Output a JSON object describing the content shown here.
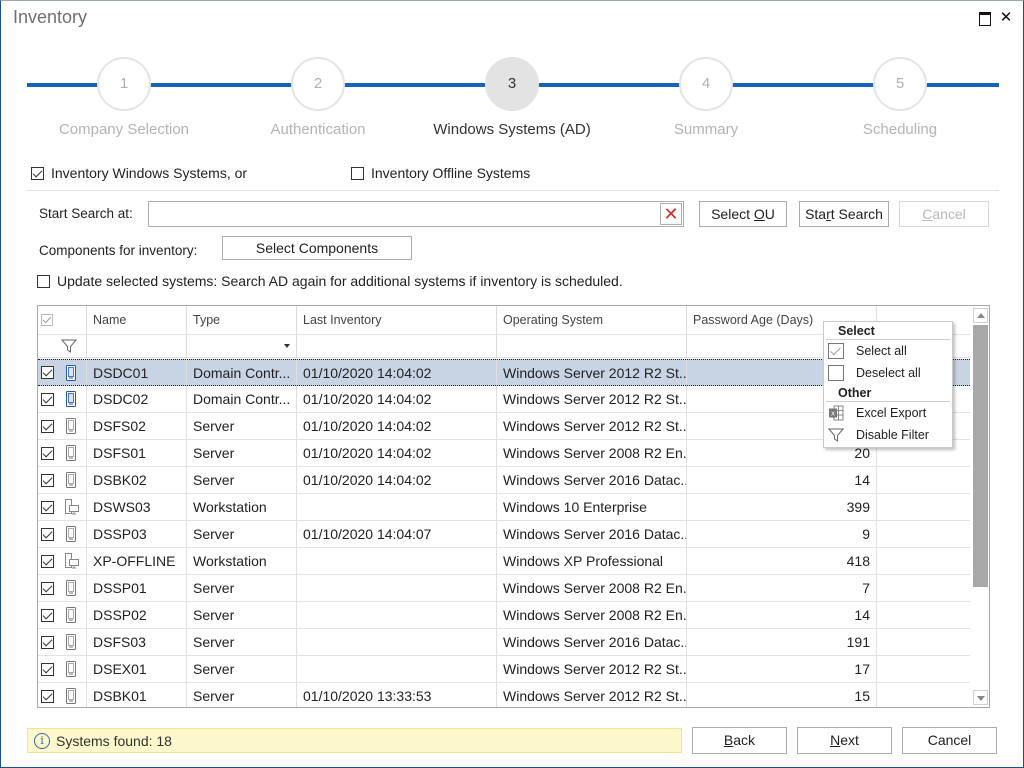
{
  "window": {
    "title": "Inventory",
    "maximize_icon": "maximize-icon",
    "close_glyph": "✕"
  },
  "stepper": {
    "active_step": 3,
    "steps": [
      {
        "number": "1",
        "label": "Company Selection"
      },
      {
        "number": "2",
        "label": "Authentication"
      },
      {
        "number": "3",
        "label": "Windows Systems (AD)"
      },
      {
        "number": "4",
        "label": "Summary"
      },
      {
        "number": "5",
        "label": "Scheduling"
      }
    ],
    "accent_color": "#1565b8"
  },
  "options": {
    "inventory_windows": {
      "label": "Inventory Windows Systems, or",
      "checked": true
    },
    "inventory_offline": {
      "label": "Inventory Offline Systems",
      "checked": false
    }
  },
  "search": {
    "label": "Start Search at:",
    "value": "",
    "placeholder": "",
    "clear_glyph": "✕",
    "select_ou_pre": "Select ",
    "select_ou_u": "O",
    "select_ou_post": "U",
    "start_pre": "Sta",
    "start_u": "r",
    "start_post": "t Search",
    "cancel_u": "C",
    "cancel_post": "ancel"
  },
  "components": {
    "label": "Components for inventory:",
    "button": "Select Components"
  },
  "update_option": {
    "label": "Update selected systems: Search AD again for additional systems if inventory is scheduled.",
    "checked": false
  },
  "grid": {
    "columns": [
      "Name",
      "Type",
      "Last Inventory",
      "Operating System",
      "Password Age (Days)"
    ],
    "rows": [
      {
        "checked": true,
        "icon": "domain-controller",
        "name": "DSDC01",
        "type": "Domain Contr...",
        "last": "01/10/2020 14:04:02",
        "os": "Windows Server 2012 R2 St...",
        "pw": "",
        "selected": true
      },
      {
        "checked": true,
        "icon": "domain-controller",
        "name": "DSDC02",
        "type": "Domain Contr...",
        "last": "01/10/2020 14:04:02",
        "os": "Windows Server 2012 R2 St...",
        "pw": ""
      },
      {
        "checked": true,
        "icon": "server",
        "name": "DSFS02",
        "type": "Server",
        "last": "01/10/2020 14:04:02",
        "os": "Windows Server 2012 R2 St...",
        "pw": ""
      },
      {
        "checked": true,
        "icon": "server",
        "name": "DSFS01",
        "type": "Server",
        "last": "01/10/2020 14:04:02",
        "os": "Windows Server 2008 R2 En...",
        "pw": "20"
      },
      {
        "checked": true,
        "icon": "server",
        "name": "DSBK02",
        "type": "Server",
        "last": "01/10/2020 14:04:02",
        "os": "Windows Server 2016 Datac...",
        "pw": "14"
      },
      {
        "checked": true,
        "icon": "workstation",
        "name": "DSWS03",
        "type": "Workstation",
        "last": "",
        "os": "Windows 10 Enterprise",
        "pw": "399"
      },
      {
        "checked": true,
        "icon": "server",
        "name": "DSSP03",
        "type": "Server",
        "last": "01/10/2020 14:04:07",
        "os": "Windows Server 2016 Datac...",
        "pw": "9"
      },
      {
        "checked": true,
        "icon": "workstation",
        "name": "XP-OFFLINE",
        "type": "Workstation",
        "last": "",
        "os": "Windows XP Professional",
        "pw": "418"
      },
      {
        "checked": true,
        "icon": "server",
        "name": "DSSP01",
        "type": "Server",
        "last": "",
        "os": "Windows Server 2008 R2 En...",
        "pw": "7"
      },
      {
        "checked": true,
        "icon": "server",
        "name": "DSSP02",
        "type": "Server",
        "last": "",
        "os": "Windows Server 2008 R2 En...",
        "pw": "14"
      },
      {
        "checked": true,
        "icon": "server",
        "name": "DSFS03",
        "type": "Server",
        "last": "",
        "os": "Windows Server 2016 Datac...",
        "pw": "191"
      },
      {
        "checked": true,
        "icon": "server",
        "name": "DSEX01",
        "type": "Server",
        "last": "",
        "os": "Windows Server 2012 R2 St...",
        "pw": "17"
      },
      {
        "checked": true,
        "icon": "server",
        "name": "DSBK01",
        "type": "Server",
        "last": "01/10/2020 13:33:53",
        "os": "Windows Server 2012 R2 St...",
        "pw": "15"
      }
    ]
  },
  "context_menu": {
    "select_header": "Select",
    "select_all": "Select all",
    "deselect_all": "Deselect all",
    "other_header": "Other",
    "excel_export": "Excel Export",
    "disable_filter": "Disable Filter"
  },
  "footer": {
    "status_text": "Systems found:  18",
    "back_u": "B",
    "back_post": "ack",
    "next_u": "N",
    "next_post": "ext",
    "cancel": "Cancel"
  }
}
